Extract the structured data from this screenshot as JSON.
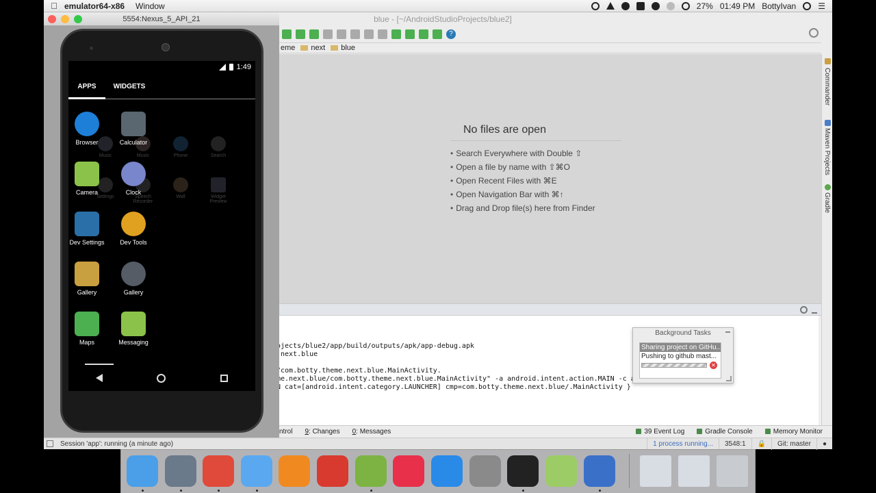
{
  "menubar": {
    "app_name": "emulator64-x86",
    "menus": [
      "Window"
    ],
    "battery": "27%",
    "time": "01:49 PM",
    "user": "BottyIvan"
  },
  "ide": {
    "title": "blue - [~/AndroidStudioProjects/blue2]",
    "breadcrumbs": [
      "eme",
      "next",
      "blue"
    ],
    "editor": {
      "heading": "No files are open",
      "hints": [
        "Search Everywhere with Double ⇧",
        "Open a file by name with ⇧⌘O",
        "Open Recent Files with ⌘E",
        "Open Navigation Bar with ⌘↑",
        "Drag and Drop file(s) here from Finder"
      ]
    },
    "right_tabs": [
      "Commander",
      "Maven Projects",
      "Gradle"
    ],
    "console_lines": [
      "ojects/blue2/app/build/outputs/apk/app-debug.apk",
      ".next.blue",
      "",
      "/com.botty.theme.next.blue.MainActivity.",
      "me.next.blue/com.botty.theme.next.blue.MainActivity\" -a android.intent.action.MAIN -c android",
      "N cat=[android.intent.category.LAUNCHER] cmp=com.botty.theme.next.blue/.MainActivity }"
    ],
    "tool_tabs": {
      "left": [
        {
          "num": "",
          "label": "ntrol"
        },
        {
          "num": "9",
          "label": ": Changes"
        },
        {
          "num": "0",
          "label": ": Messages"
        }
      ],
      "right": [
        "39 Event Log",
        "Gradle Console",
        "Memory Monitor"
      ]
    },
    "status": {
      "session": "Session 'app': running (a minute ago)",
      "process": "1 process running...",
      "position": "3548:1",
      "git": "Git: master"
    },
    "bg_tasks": {
      "title": "Background Tasks",
      "task_title": "Sharing project on GitHu...",
      "task_sub": "Pushing to github mast..."
    }
  },
  "emulator": {
    "title": "5554:Nexus_5_API_21",
    "time": "1:49",
    "tabs": [
      "APPS",
      "WIDGETS"
    ],
    "apps": [
      {
        "label": "Browser",
        "color": "#1e7fd8"
      },
      {
        "label": "Calculator",
        "color": "#5a6670"
      },
      {
        "label": "Camera",
        "color": "#8bc34a"
      },
      {
        "label": "Clock",
        "color": "#7986cb"
      },
      {
        "label": "Dev Settings",
        "color": "#2b6fa8"
      },
      {
        "label": "Dev Tools",
        "color": "#e0a020"
      },
      {
        "label": "Gallery",
        "color": "#c9a040"
      },
      {
        "label": "Gallery",
        "color": "#555c66"
      },
      {
        "label": "Maps",
        "color": "#4caf50"
      },
      {
        "label": "Messaging",
        "color": "#8bc34a"
      }
    ],
    "ghost_widgets": [
      {
        "label": "Music"
      },
      {
        "label": "Music"
      },
      {
        "label": "Phone"
      },
      {
        "label": "Search"
      },
      {
        "label": "Settings"
      },
      {
        "label": "Speech Recorder"
      },
      {
        "label": "Wall"
      },
      {
        "label": "Widget Preview"
      }
    ]
  },
  "dock": {
    "items": [
      {
        "name": "finder-icon",
        "color": "#4a9fe8"
      },
      {
        "name": "launchpad-icon",
        "color": "#6a7a8a"
      },
      {
        "name": "chrome-icon",
        "color": "#e04a3a"
      },
      {
        "name": "messages-icon",
        "color": "#5aa8f0"
      },
      {
        "name": "headphones-icon",
        "color": "#f08a20"
      },
      {
        "name": "video-icon",
        "color": "#d83a30"
      },
      {
        "name": "android-studio-icon",
        "color": "#7cb342"
      },
      {
        "name": "itunes-icon",
        "color": "#e8304a"
      },
      {
        "name": "app-store-icon",
        "color": "#2a8ae8"
      },
      {
        "name": "system-preferences-icon",
        "color": "#8a8a8a"
      },
      {
        "name": "terminal-icon",
        "color": "#222222"
      },
      {
        "name": "android-sdk-icon",
        "color": "#9ccc65"
      },
      {
        "name": "quicktime-icon",
        "color": "#3a70c8"
      },
      {
        "name": "window-thumbnail-icon",
        "color": "#d8dde4"
      },
      {
        "name": "window-thumbnail-icon",
        "color": "#d8dde4"
      },
      {
        "name": "trash-icon",
        "color": "#c8ccd0"
      }
    ]
  }
}
